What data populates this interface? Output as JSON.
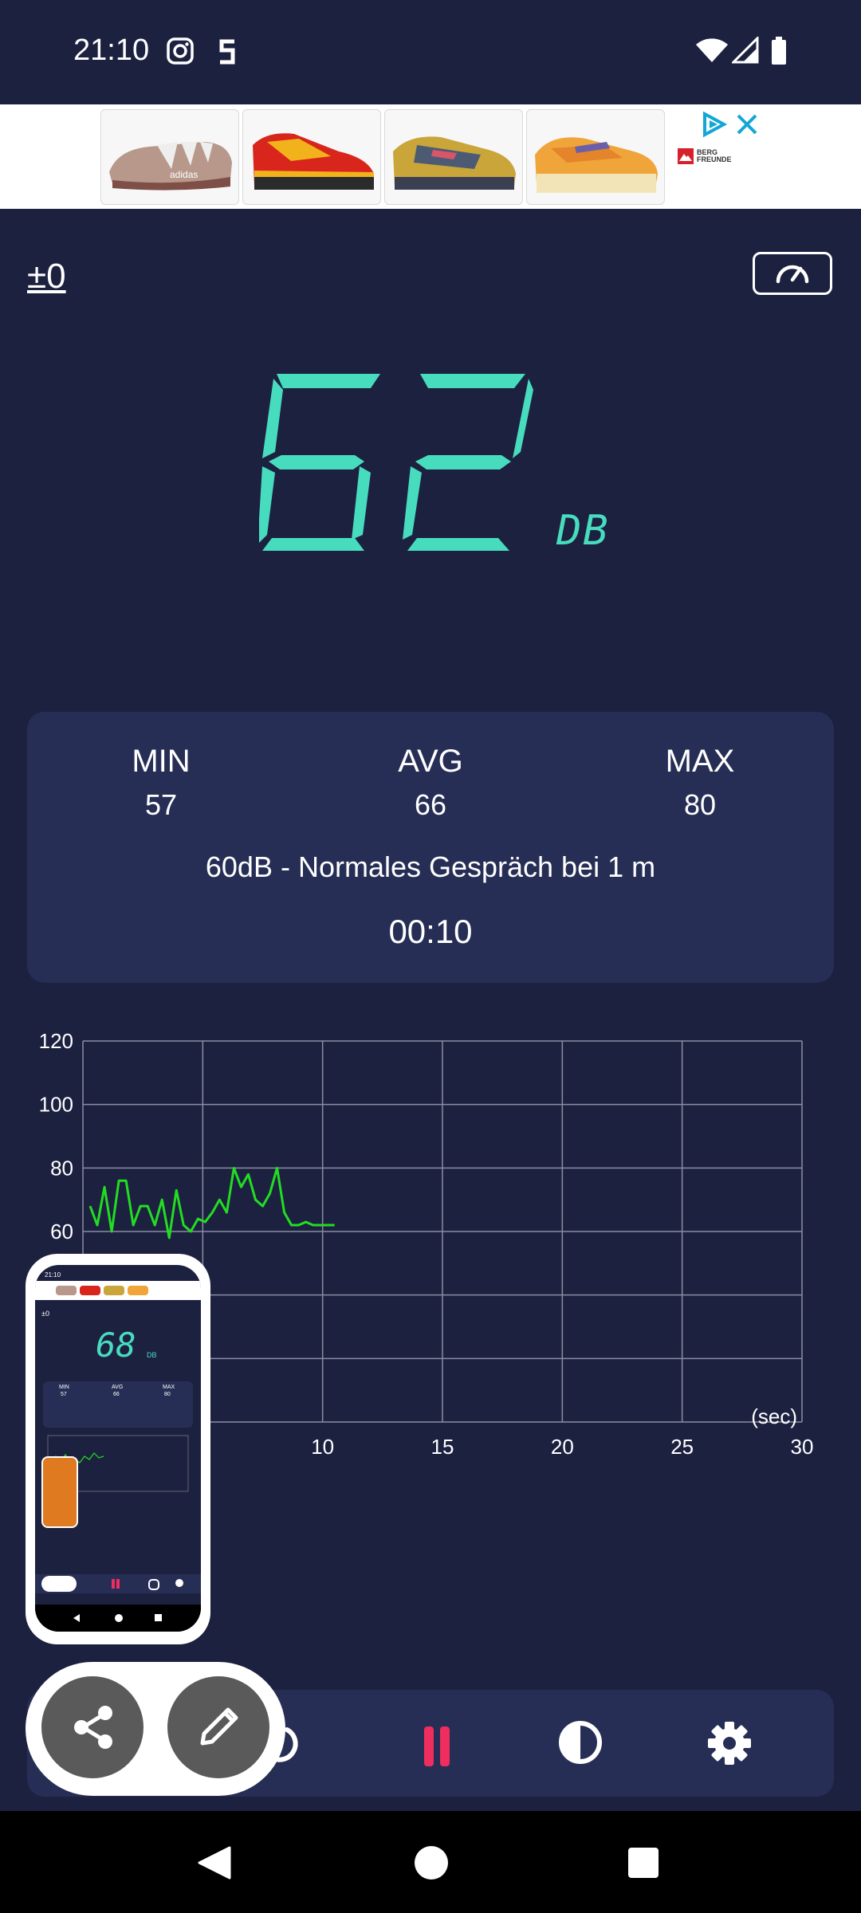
{
  "status_bar": {
    "time": "21:10",
    "icons": [
      "instagram-icon",
      "s-app-icon",
      "wifi-icon",
      "signal-icon",
      "battery-icon"
    ]
  },
  "ad": {
    "brand": "BERG FREUNDE",
    "items": [
      "adidas slide",
      "red hiking shoe",
      "yellow trail shoe",
      "orange running shoe"
    ],
    "shoe_text": "adidas"
  },
  "calibration": {
    "value": "±0"
  },
  "reading": {
    "value": "62",
    "unit": "DB",
    "color": "#48dcbf"
  },
  "stats": {
    "min_label": "MIN",
    "min_value": "57",
    "avg_label": "AVG",
    "avg_value": "66",
    "max_label": "MAX",
    "max_value": "80",
    "reference": "60dB - Normales Gespräch bei 1 m",
    "elapsed": "00:10"
  },
  "chart_data": {
    "type": "line",
    "xlim": [
      0,
      30
    ],
    "ylim": [
      0,
      120
    ],
    "y_ticks": [
      "120",
      "100",
      "80",
      "60"
    ],
    "x_ticks": [
      "10",
      "15",
      "20",
      "25",
      "30"
    ],
    "x_unit": "(sec)",
    "grid": true,
    "line_color": "#22dd22",
    "x": [
      0.3,
      0.6,
      0.9,
      1.2,
      1.5,
      1.8,
      2.1,
      2.4,
      2.7,
      3.0,
      3.3,
      3.6,
      3.9,
      4.2,
      4.5,
      4.8,
      5.1,
      5.4,
      5.7,
      6.0,
      6.3,
      6.6,
      6.9,
      7.2,
      7.5,
      7.8,
      8.1,
      8.4,
      8.7,
      9.0,
      9.3,
      9.6,
      9.9,
      10.2,
      10.5
    ],
    "values": [
      68,
      62,
      74,
      60,
      76,
      76,
      62,
      68,
      68,
      62,
      70,
      58,
      73,
      62,
      60,
      64,
      63,
      66,
      70,
      66,
      80,
      74,
      78,
      70,
      68,
      72,
      80,
      66,
      62,
      62,
      63,
      62,
      62,
      62,
      62
    ]
  },
  "bottom_bar": {
    "icons": [
      "share-icon",
      "edit-icon",
      "reset-icon",
      "pause-icon",
      "contrast-icon",
      "settings-icon"
    ],
    "pause_color": "#ef2d5e"
  },
  "preview": {
    "value": "68",
    "unit": "DB",
    "time": "21:10",
    "min_label": "MIN",
    "avg_label": "AVG",
    "max_label": "MAX",
    "min_value": "57",
    "avg_value": "66",
    "max_value": "80",
    "calibration": "±0"
  }
}
